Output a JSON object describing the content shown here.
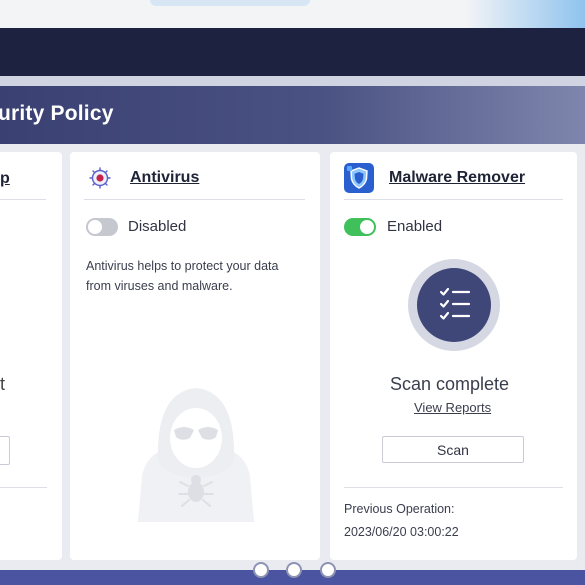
{
  "header": {
    "title": "urity Policy"
  },
  "cards": {
    "left": {
      "title_fragment": "p",
      "status_fragment": "t"
    },
    "antivirus": {
      "title": "Antivirus",
      "toggle_label": "Disabled",
      "toggle_state": "off",
      "description_line1": "Antivirus helps to protect your data",
      "description_line2": "from viruses and malware.",
      "icon": "antivirus-icon"
    },
    "malware": {
      "title": "Malware Remover",
      "toggle_label": "Enabled",
      "toggle_state": "on",
      "status": "Scan complete",
      "view_reports": "View Reports",
      "scan_button": "Scan",
      "previous_operation_label": "Previous Operation:",
      "previous_operation_value": "2023/06/20 03:00:22",
      "icon": "shield-icon",
      "status_icon": "checklist-icon"
    }
  },
  "colors": {
    "header_bg": "#3a4172",
    "enabled_green": "#3fc05a",
    "disabled_gray": "#c6c8cf",
    "scan_icon_bg": "#3f4678"
  }
}
